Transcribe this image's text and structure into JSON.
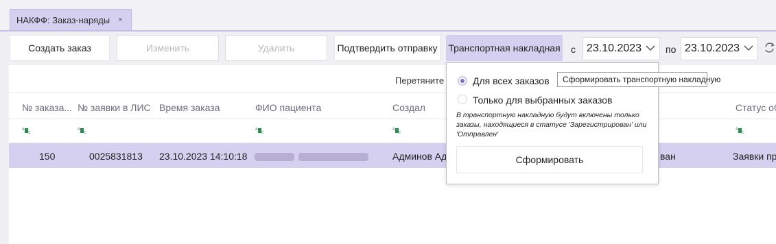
{
  "tab": {
    "title": "НАКФФ: Заказ-наряды",
    "close": "×"
  },
  "toolbar": {
    "create": "Создать заказ",
    "edit": "Изменить",
    "delete": "Удалить",
    "confirm": "Подтвердить отправку",
    "waybill": "Транспортная накладная",
    "from_label": "с",
    "from_date": "23.10.2023",
    "to_label": "по",
    "to_date": "23.10.2023"
  },
  "grid": {
    "group_hint": "Перетяните",
    "columns": [
      "№ заказа...",
      "№ заявки в ЛИС",
      "Время заказа",
      "ФИО пациента",
      "Создал",
      "Статус об"
    ],
    "filter_icon": "abc-filter-icon",
    "rows": [
      {
        "order_no": "150",
        "lis_no": "0025831813",
        "time": "23.10.2023 14:10:18",
        "creator": "Админов Ад",
        "status_partial": "ван",
        "order_status": "Заявки пр"
      }
    ]
  },
  "popup": {
    "option_all": "Для всех заказов",
    "option_selected": "Только для выбранных заказов",
    "selected_option": "all",
    "note": "В транспортную накладную будут включены только заказы, находящиеся в статусе 'Зарегистрирован' или 'Отправлен'",
    "button": "Сформировать"
  },
  "tooltip": "Сформировать транспортную накладную",
  "colors": {
    "accent": "#d5cff0",
    "radio": "#7c6cc0"
  }
}
